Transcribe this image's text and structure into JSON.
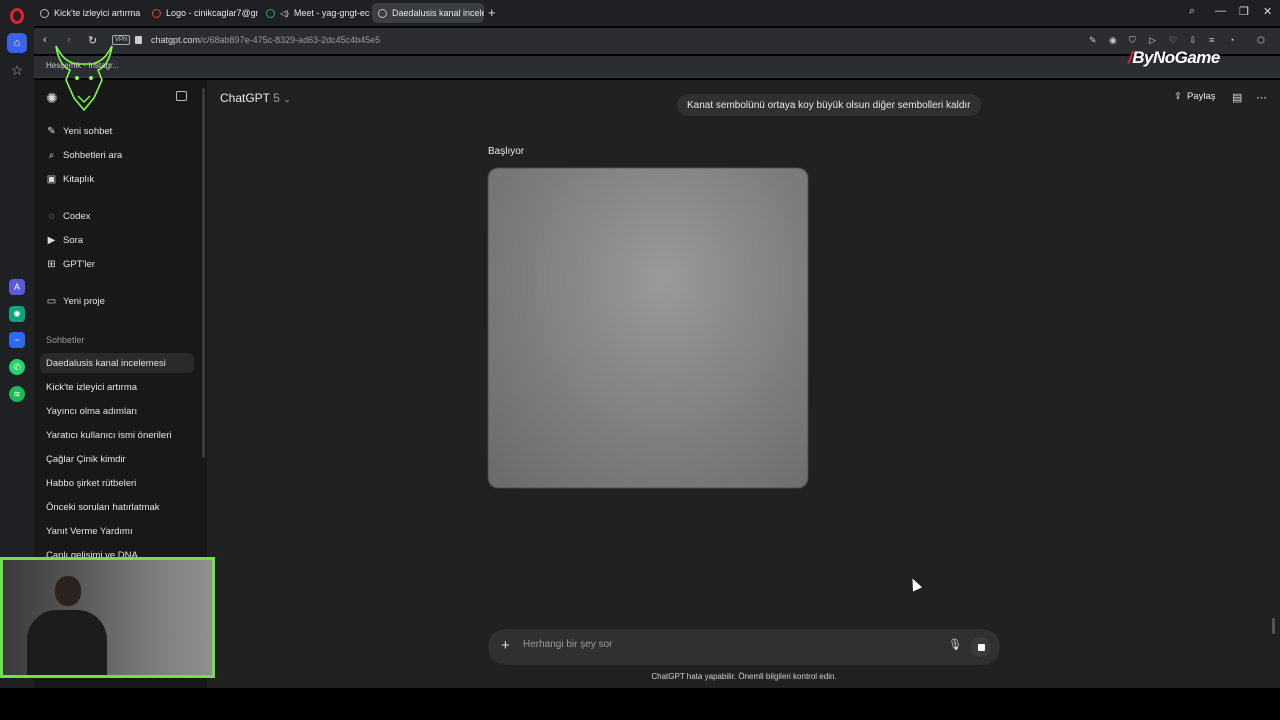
{
  "browser": {
    "tabs": [
      {
        "label": "Kick'te izleyici artırma"
      },
      {
        "label": "Logo - cinikcaglar7@gma"
      },
      {
        "label": "Meet - yag-gngt-ecg"
      },
      {
        "label": "Daedalusis kanal inceleme"
      }
    ],
    "vpn_label": "VPN",
    "url_host": "chatgpt.com",
    "url_path": "/c/68ab897e-475c-8329-ad63-2dc45c4b45e5",
    "bookmark_label": "Hesçemik - Instagr...",
    "watermark": "ByNoGame"
  },
  "sidebar": {
    "primary": [
      {
        "label": "Yeni sohbet",
        "icon": "edit-icon"
      },
      {
        "label": "Sohbetleri ara",
        "icon": "search-icon"
      },
      {
        "label": "Kitaplık",
        "icon": "library-icon"
      }
    ],
    "secondary": [
      {
        "label": "Codex",
        "icon": "codex-icon"
      },
      {
        "label": "Sora",
        "icon": "sora-icon"
      },
      {
        "label": "GPT'ler",
        "icon": "grid-icon"
      }
    ],
    "project": {
      "label": "Yeni proje",
      "icon": "folder-icon"
    },
    "chats_heading": "Sohbetler",
    "chats": [
      "Daedalusis kanal incelemesi",
      "Kick'te izleyici artırma",
      "Yayıncı olma adımları",
      "Yaratıcı kullanıcı ismi önerileri",
      "Çağlar Çinik kimdir",
      "Habbo şirket rütbeleri",
      "Önceki soruları hatırlatmak",
      "Yanıt Verme Yardımı",
      "Canlı gelişimi ve DNA"
    ]
  },
  "header": {
    "model": "ChatGPT",
    "model_version": "5",
    "share_label": "Paylaş"
  },
  "conversation": {
    "user_message": "Kanat sembolünü ortaya koy büyük olsun diğer sembolleri kaldır",
    "assistant_status": "Başlıyor"
  },
  "composer": {
    "placeholder": "Herhangi bir şey sor"
  },
  "footer": {
    "disclaimer": "ChatGPT hata yapabilir. Önemli bilgileri kontrol edin."
  },
  "colors": {
    "main_bg": "#212121",
    "sidebar_bg": "#181818",
    "bubble_bg": "#303030",
    "webcam_border": "#6de34a",
    "opera_red": "#e0242b"
  }
}
